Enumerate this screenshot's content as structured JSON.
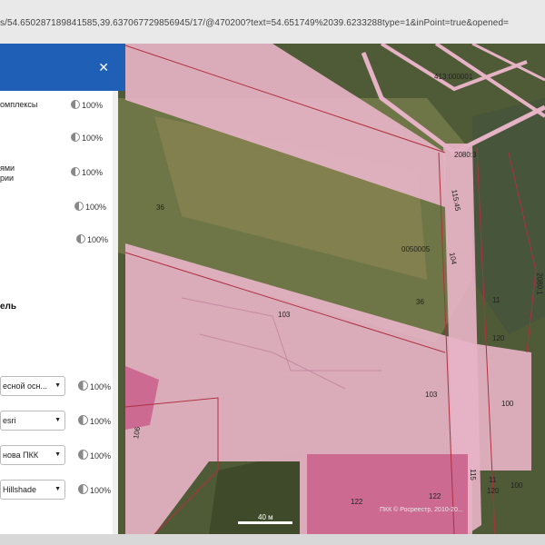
{
  "browser": {
    "url": "s/54.650287189841585,39.637067729856945/17/@470200?text=54.651749%2039.6233288type=1&inPoint=true&opened="
  },
  "panel": {
    "close_glyph": "✕",
    "layers": [
      {
        "label": "омплексы",
        "opacity": "100%"
      },
      {
        "label": "",
        "opacity": "100%"
      },
      {
        "label": "ями\nрии",
        "opacity": "100%"
      },
      {
        "label": "",
        "opacity": "100%"
      },
      {
        "label": "",
        "opacity": "100%"
      }
    ],
    "basemap_title": "ель",
    "basemaps": [
      {
        "value": "есной осн...",
        "opacity": "100%"
      },
      {
        "value": "esri",
        "opacity": "100%"
      },
      {
        "value": "нова ПКК",
        "opacity": "100%"
      },
      {
        "value": "Hillshade",
        "opacity": "100%"
      }
    ]
  },
  "map": {
    "parcel_labels": [
      "413:000001",
      "2080:3",
      "115:45",
      "0050005",
      "104",
      "36",
      "36",
      "11",
      "120",
      "2080:1",
      "103",
      "103",
      "100",
      "106",
      "122",
      "122",
      "115",
      "11",
      "120",
      "100"
    ],
    "scale": "40 м",
    "copyright": "ПКК © Росреестр, 2010-20..."
  }
}
